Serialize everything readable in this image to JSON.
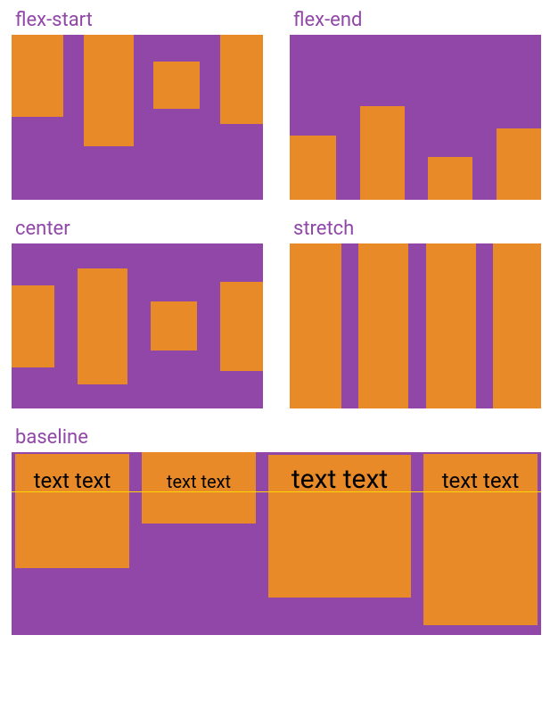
{
  "colors": {
    "purple": "#9147a8",
    "orange": "#e88a27",
    "baseline_line": "#ffd700"
  },
  "panels": {
    "flex_start": {
      "title": "flex-start"
    },
    "flex_end": {
      "title": "flex-end"
    },
    "center": {
      "title": "center"
    },
    "stretch": {
      "title": "stretch"
    },
    "baseline": {
      "title": "baseline",
      "items": [
        {
          "text": "text text"
        },
        {
          "text": "text text"
        },
        {
          "text": "text text"
        },
        {
          "text": "text text"
        }
      ]
    }
  }
}
